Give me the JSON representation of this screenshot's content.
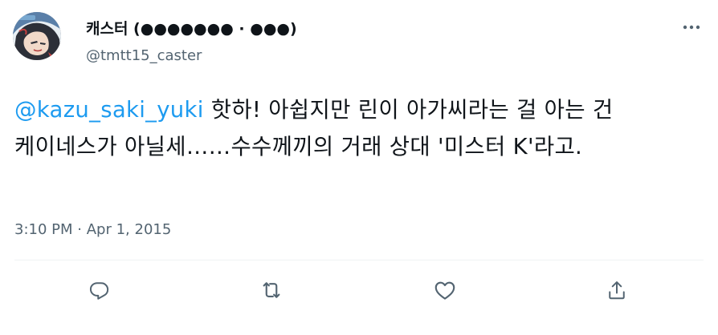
{
  "author": {
    "display_name": "캐스터 (●●●●●●● · ●●●)",
    "handle": "@tmtt15_caster",
    "avatar_icon": "profile-avatar-illustration"
  },
  "tweet": {
    "mention": "@kazu_saki_yuki",
    "text_after_mention": " 핫하! 아쉽지만 린이 아가씨라는 걸 아는 건 케이네스가 아닐세……수수께끼의 거래 상대 '미스터 K'라고.",
    "time": "3:10 PM",
    "separator": "·",
    "date": "Apr 1, 2015"
  },
  "icons": {
    "more": "more-horizontal-icon",
    "reply": "reply-icon",
    "retweet": "retweet-icon",
    "like": "like-icon",
    "share": "share-icon"
  },
  "colors": {
    "text": "#0f1419",
    "secondary": "#536471",
    "accent": "#1d9bf0",
    "divider": "#eff3f4"
  }
}
